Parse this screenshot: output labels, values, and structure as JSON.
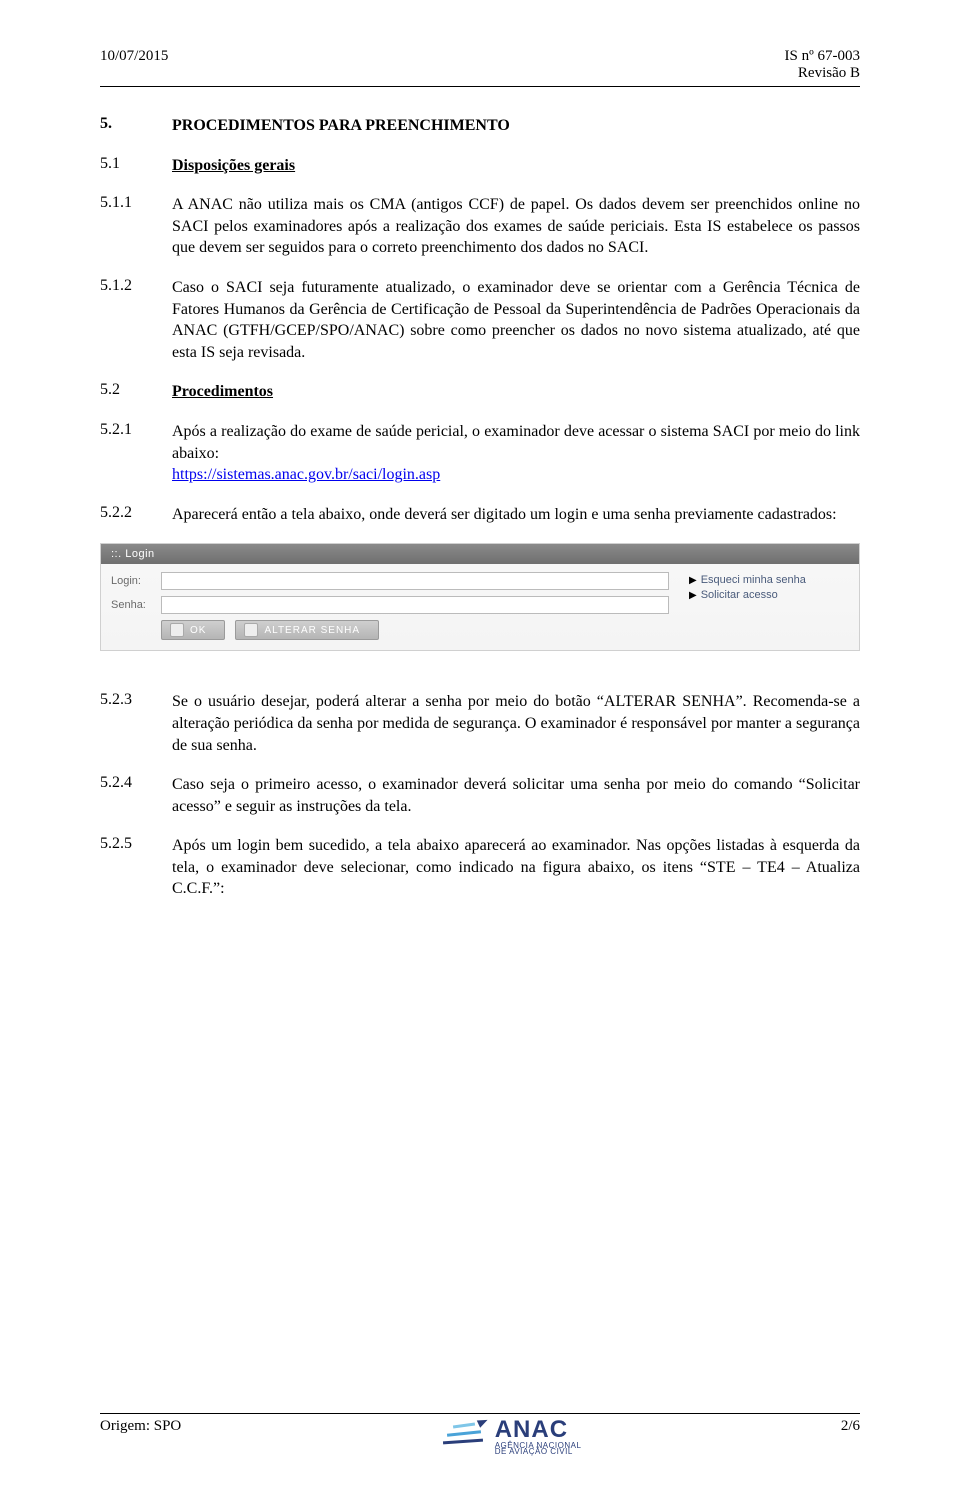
{
  "header": {
    "date": "10/07/2015",
    "doc_id": "IS nº 67-003",
    "revision": "Revisão B"
  },
  "sections": [
    {
      "num": "5.",
      "title": "PROCEDIMENTOS PARA PREENCHIMENTO",
      "type": "h1"
    },
    {
      "num": "5.1",
      "title": "Disposições gerais",
      "type": "h2"
    },
    {
      "num": "5.1.1",
      "type": "p",
      "body": "A ANAC não utiliza mais os CMA (antigos CCF) de papel. Os dados devem ser preenchidos online no SACI pelos examinadores após a realização dos exames de saúde periciais. Esta IS estabelece os passos que devem ser seguidos para o correto preenchimento dos dados no SACI."
    },
    {
      "num": "5.1.2",
      "type": "p",
      "body": "Caso o SACI seja futuramente atualizado, o examinador deve se orientar com a Gerência Técnica de Fatores Humanos da Gerência de Certificação de Pessoal da Superintendência de Padrões Operacionais da ANAC (GTFH/GCEP/SPO/ANAC) sobre como preencher os dados no novo sistema atualizado, até que esta IS seja revisada."
    },
    {
      "num": "5.2",
      "title": "Procedimentos",
      "type": "h2"
    },
    {
      "num": "5.2.1",
      "type": "p_link",
      "body_pre": "Após a realização do exame de saúde pericial, o examinador deve acessar o sistema SACI por meio do link abaixo:",
      "link_text": "https://sistemas.anac.gov.br/saci/login.asp"
    },
    {
      "num": "5.2.2",
      "type": "p",
      "body": "Aparecerá então a tela abaixo, onde deverá ser digitado um login e uma senha previamente cadastrados:"
    },
    {
      "type": "login_panel"
    },
    {
      "num": "5.2.3",
      "type": "p",
      "body": "Se o usuário desejar, poderá alterar a senha por meio do botão “ALTERAR SENHA”. Recomenda-se a alteração periódica da senha por medida de segurança. O examinador é responsável por manter a segurança de sua senha."
    },
    {
      "num": "5.2.4",
      "type": "p",
      "body": "Caso seja o primeiro acesso, o examinador deverá solicitar uma senha por meio do comando “Solicitar acesso” e seguir as instruções da tela."
    },
    {
      "num": "5.2.5",
      "type": "p",
      "body": "Após um login bem sucedido, a tela abaixo aparecerá ao examinador. Nas opções listadas à esquerda da tela, o examinador deve selecionar, como indicado na figura abaixo, os itens “STE – TE4 – Atualiza C.C.F.”:"
    }
  ],
  "login": {
    "title": "::. Login",
    "login_label": "Login:",
    "senha_label": "Senha:",
    "btn_ok": "OK",
    "btn_alterar": "Alterar Senha",
    "link_forgot": "Esqueci minha senha",
    "link_request": "Solicitar acesso"
  },
  "footer": {
    "origin": "Origem: SPO",
    "page": "2/6",
    "logo_name": "ANAC",
    "logo_sub1": "AGÊNCIA NACIONAL",
    "logo_sub2": "DE AVIAÇÃO CIVIL"
  }
}
